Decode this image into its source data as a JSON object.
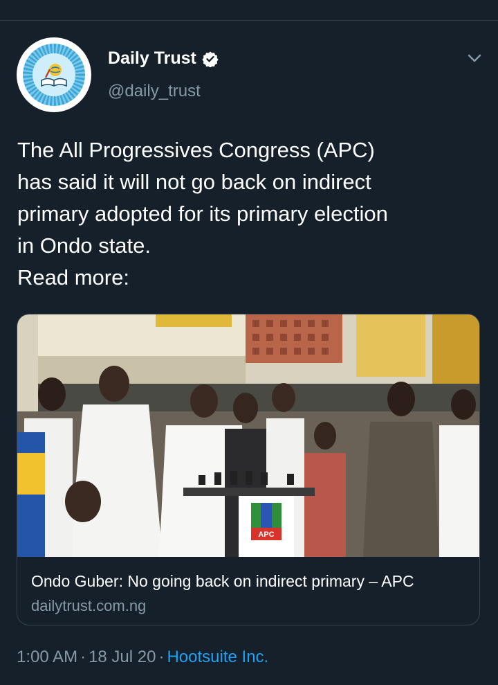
{
  "tweet": {
    "author_name": "Daily Trust",
    "author_handle": "@daily_trust",
    "text_lines": [
      "The All Progressives Congress (APC)",
      "has said it will not go back on indirect",
      "primary adopted for its primary election",
      "in Ondo state.",
      "Read more:"
    ],
    "card": {
      "title": "Ondo Guber: No going back on indirect primary – APC",
      "domain": "dailytrust.com.ng",
      "image_overlay_text": "APC"
    },
    "time": "1:00 AM",
    "date": "18 Jul 20",
    "source": "Hootsuite Inc.",
    "separator": "·"
  },
  "icons": {
    "verified": "verified-badge-icon",
    "menu": "chevron-down-icon"
  },
  "colors": {
    "background": "#15202b",
    "secondary_text": "#8899a6",
    "link": "#1da1f2",
    "border": "#38444d"
  }
}
